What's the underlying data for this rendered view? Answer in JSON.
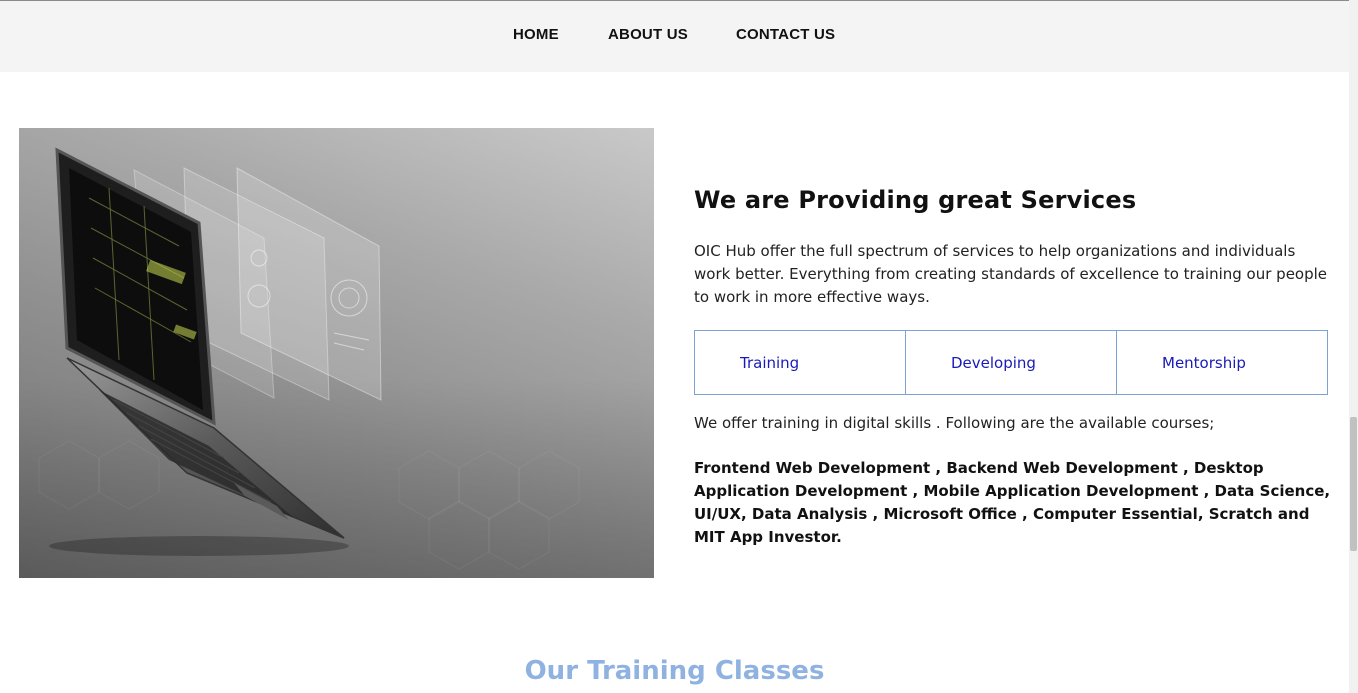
{
  "nav": {
    "items": [
      {
        "label": "HOME"
      },
      {
        "label": "ABOUT US"
      },
      {
        "label": "CONTACT US"
      }
    ]
  },
  "services": {
    "title": "We are Providing great Services",
    "intro": "OIC Hub offer the full spectrum of services to help organizations and individuals work better. Everything from creating standards of excellence to training our people to work in more effective ways.",
    "tabs": [
      {
        "label": "Training"
      },
      {
        "label": "Developing"
      },
      {
        "label": "Mentorship"
      }
    ],
    "offer": "We offer training in digital skills . Following are the available courses;",
    "courses": "Frontend Web Development , Backend Web Development , Desktop Application Development , Mobile Application Development , Data Science, UI/UX, Data Analysis , Microsoft Office , Computer Essential, Scratch and MIT App Investor."
  },
  "training": {
    "heading": "Our Training Classes"
  },
  "colors": {
    "nav_bg": "#f4f4f4",
    "tab_border": "#7aa3d4",
    "tab_text": "#1a1ab8",
    "heading_accent": "#8fb2e0"
  }
}
